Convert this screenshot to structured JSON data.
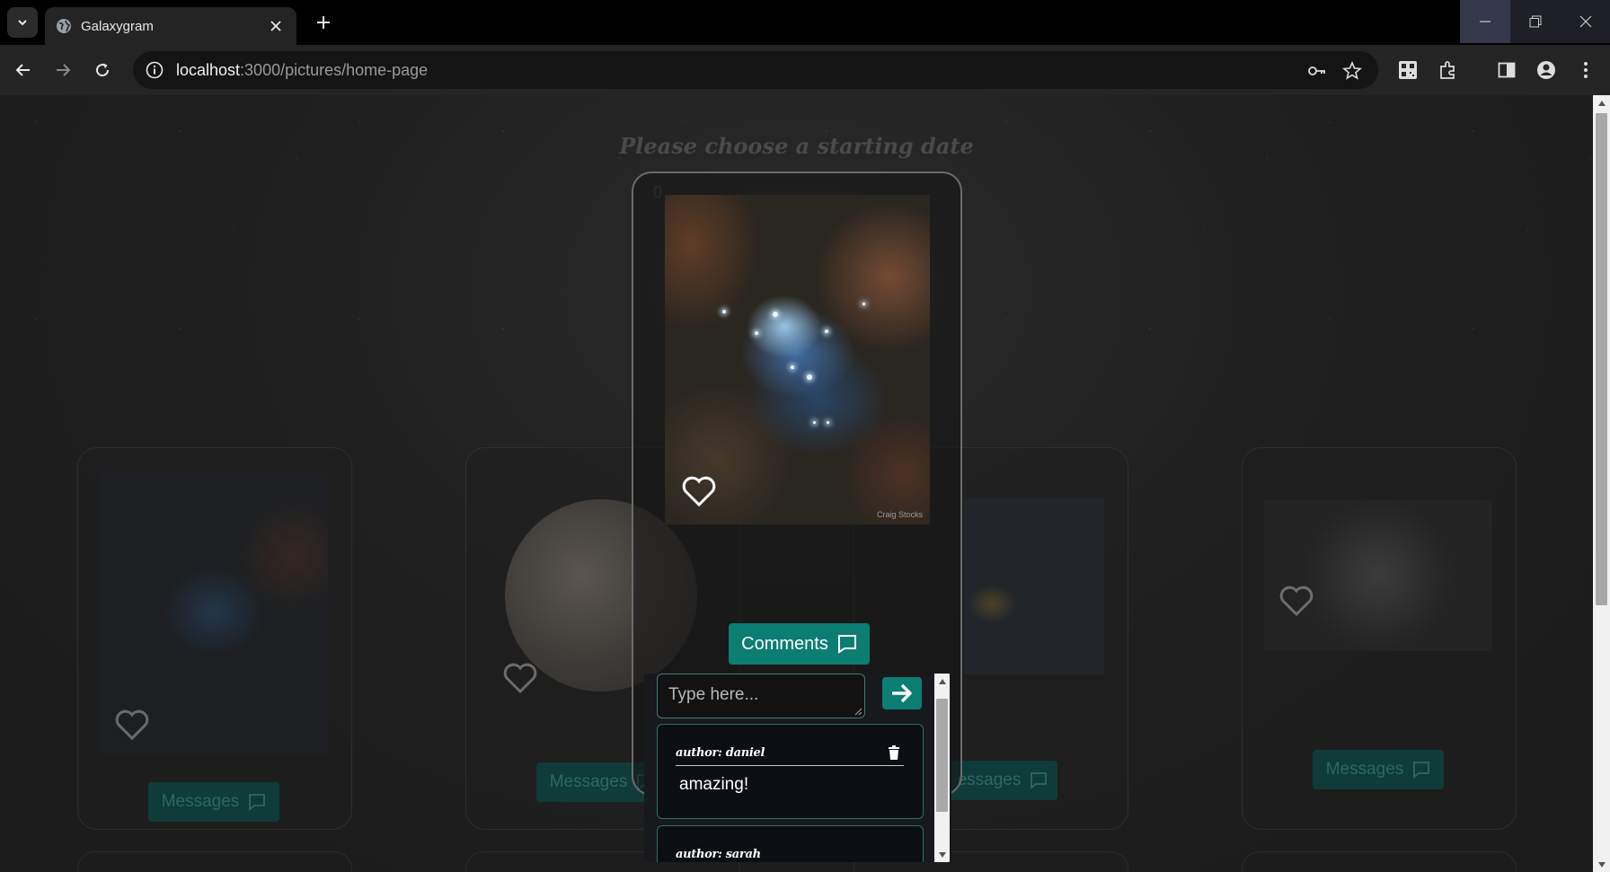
{
  "browser": {
    "tab_title": "Galaxygram",
    "url_host": "localhost",
    "url_path": ":3000/pictures/home-page"
  },
  "page": {
    "heading": "Please choose a starting date",
    "date_ghost": "0"
  },
  "background_cards": [
    {
      "button_label": "Messages"
    },
    {
      "button_label": "Messages"
    },
    {
      "button_label": "essages"
    },
    {
      "button_label": "Messages"
    }
  ],
  "modal": {
    "photo_credit": "Craig Stocks",
    "comments_button_label": "Comments",
    "comment_input_placeholder": "Type here...",
    "comments": [
      {
        "author": "author: daniel",
        "text": "amazing!"
      },
      {
        "author": "author: sarah",
        "text": ""
      }
    ]
  },
  "colors": {
    "accent": "#0b7d73",
    "page_background": "#1f1f1f",
    "comment_border": "#2f6e69"
  }
}
